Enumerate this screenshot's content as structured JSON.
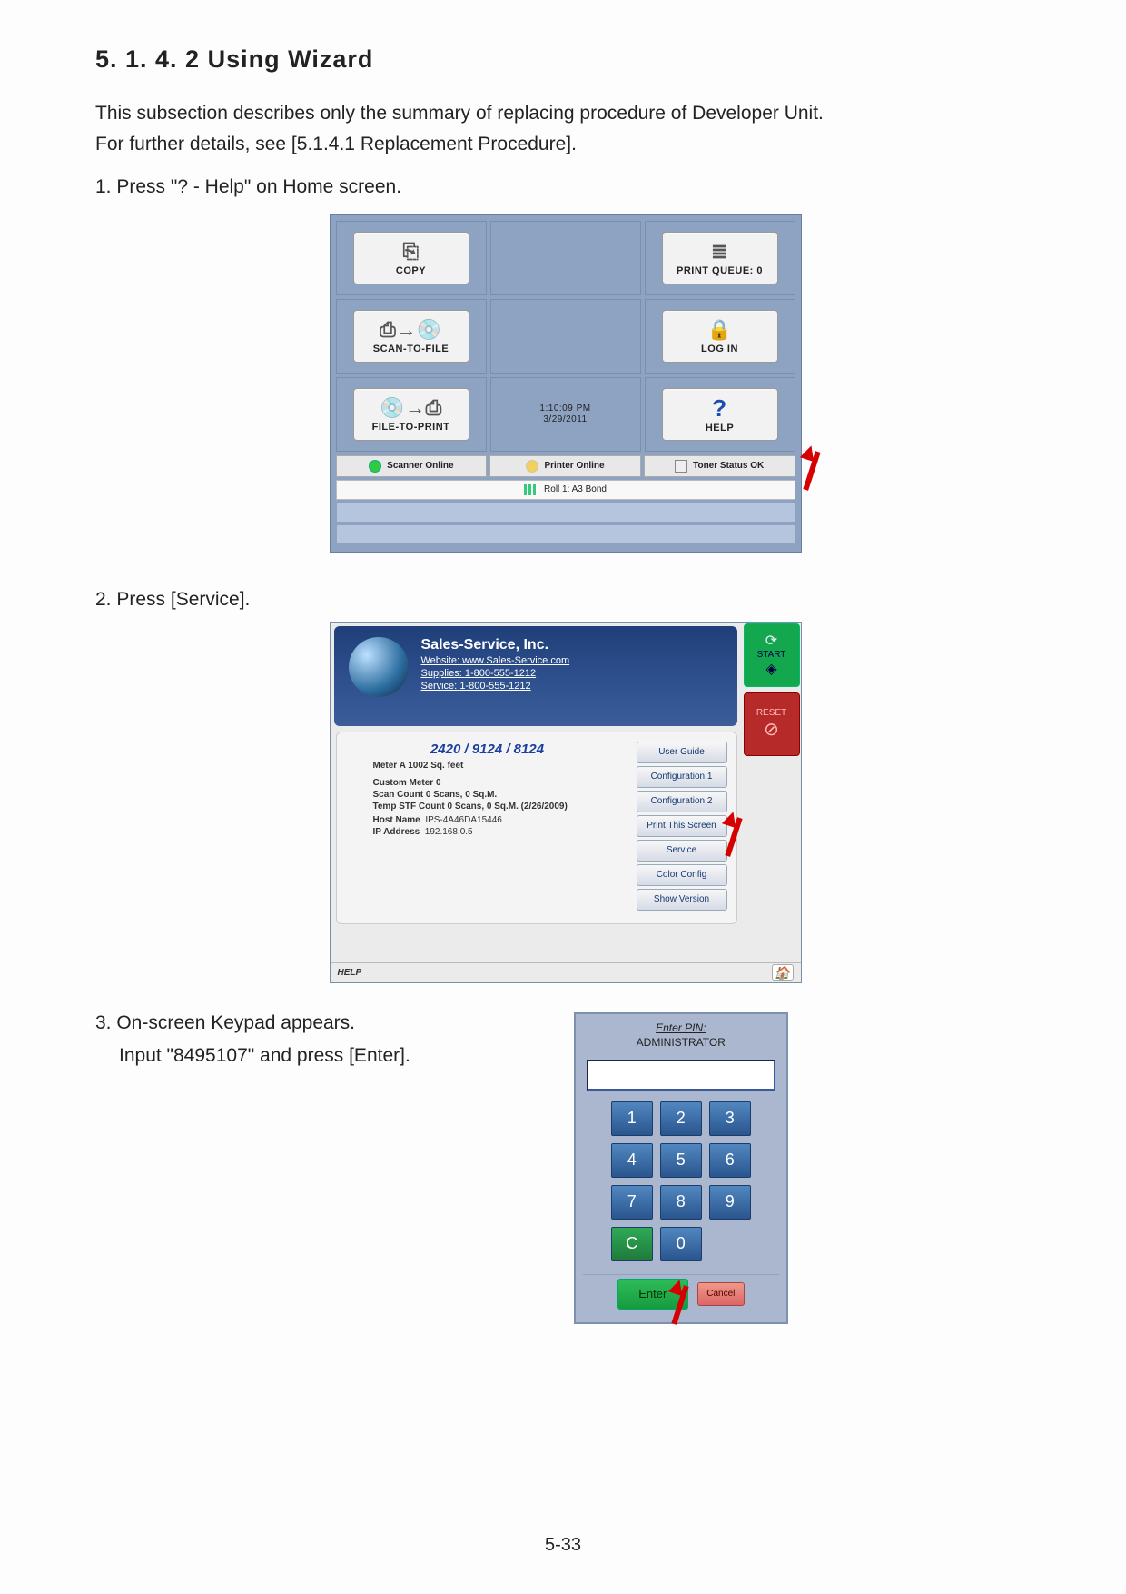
{
  "heading": "5. 1. 4. 2   Using Wizard",
  "intro_line1": "This subsection describes only the summary of replacing procedure of Developer Unit.",
  "intro_line2": "For further details, see [5.1.4.1   Replacement Procedure].",
  "step1": "1. Press \"? - Help\" on Home screen.",
  "step2": "2. Press [Service].",
  "step3a": "3. On-screen Keypad appears.",
  "step3b": "Input \"8495107\" and press [Enter].",
  "page_number": "5-33",
  "home": {
    "tiles": {
      "copy": "COPY",
      "scan_to_file": "SCAN-TO-FILE",
      "file_to_print": "FILE-TO-PRINT",
      "print_queue": "PRINT QUEUE: 0",
      "log_in": "LOG IN",
      "help": "HELP"
    },
    "time": "1:10:09 PM",
    "date": "3/29/2011",
    "status": {
      "scanner": "Scanner Online",
      "printer": "Printer Online",
      "toner": "Toner Status OK"
    },
    "roll": "Roll 1: A3 Bond"
  },
  "help_screen": {
    "company": "Sales-Service, Inc.",
    "website_label": "Website:",
    "website": "www.Sales-Service.com",
    "supplies_label": "Supplies:",
    "supplies": "1-800-555-1212",
    "service_label": "Service:",
    "service": "1-800-555-1212",
    "model": "2420 / 9124 / 8124",
    "meter_a": "Meter A  1002  Sq. feet",
    "custom_meter": "Custom Meter  0",
    "scan_count": "Scan Count  0 Scans,   0 Sq.M.",
    "temp_stf": "Temp STF Count  0 Scans,   0  Sq.M.   (2/26/2009)",
    "hostname_label": "Host Name",
    "hostname": "IPS-4A46DA15446",
    "ip_label": "IP Address",
    "ip": "192.168.0.5",
    "buttons": {
      "user_guide": "User Guide",
      "config1": "Configuration 1",
      "config2": "Configuration 2",
      "print_screen": "Print This Screen",
      "service": "Service",
      "color_config": "Color Config",
      "show_version": "Show Version"
    },
    "footer": "HELP",
    "start": "START",
    "reset": "RESET"
  },
  "keypad": {
    "title": "Enter PIN:",
    "subtitle": "ADMINISTRATOR",
    "keys": [
      "1",
      "2",
      "3",
      "4",
      "5",
      "6",
      "7",
      "8",
      "9",
      "C",
      "0"
    ],
    "enter": "Enter",
    "cancel": "Cancel"
  }
}
